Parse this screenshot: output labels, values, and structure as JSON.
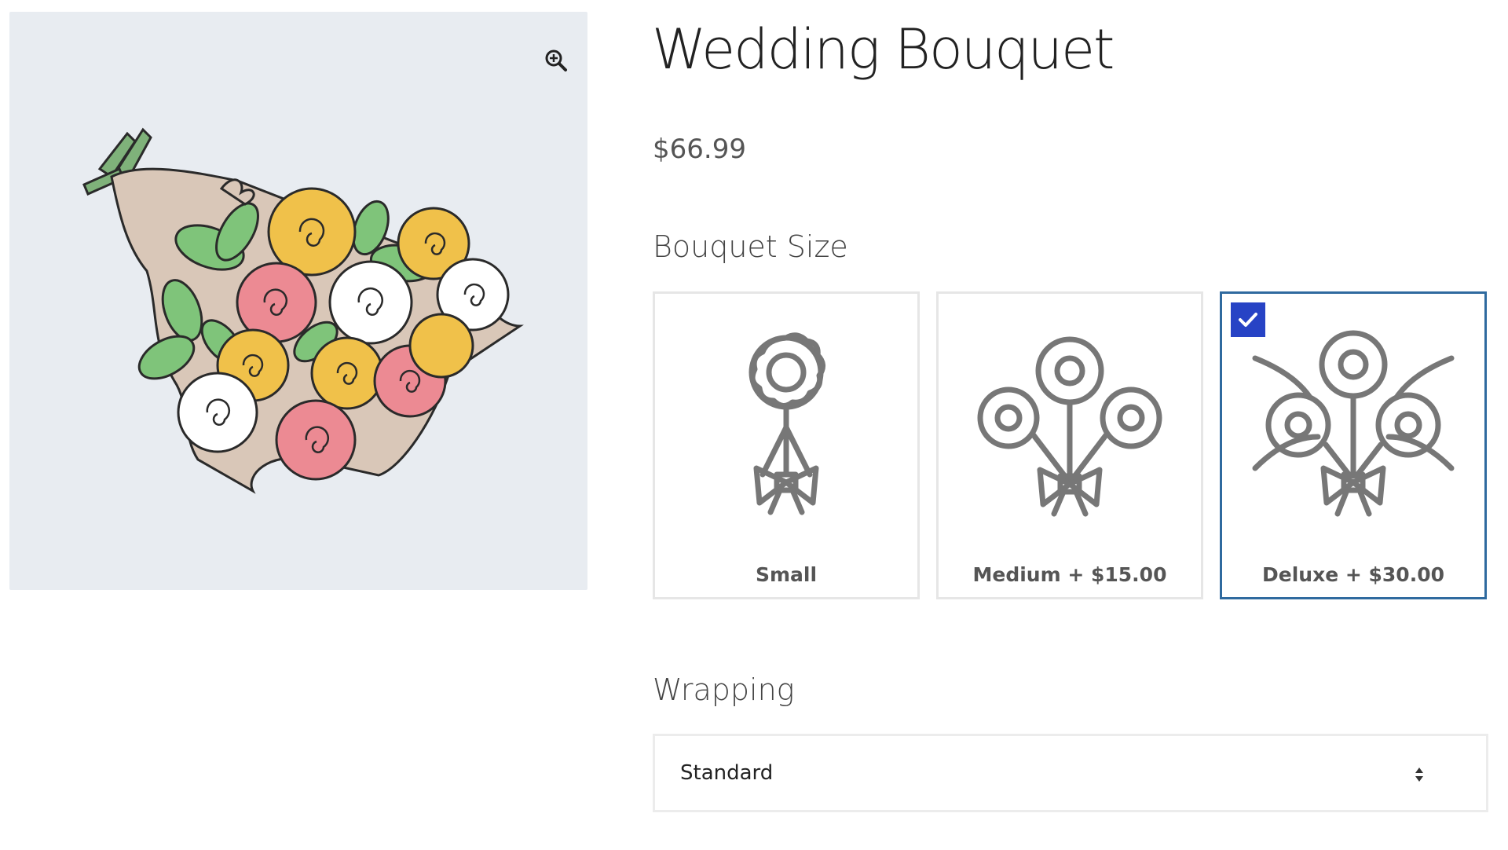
{
  "product": {
    "title": "Wedding Bouquet",
    "price": "$66.99"
  },
  "gallery": {
    "zoom_icon": "zoom-in-icon",
    "image": "illustrated-bouquet-of-roses",
    "background_color": "#e8ecf1"
  },
  "bouquet_size": {
    "label": "Bouquet Size",
    "options": [
      {
        "name": "Small",
        "icon": "single-flower-icon",
        "selected": false
      },
      {
        "name": "Medium + $15.00",
        "icon": "three-flower-bouquet-icon",
        "selected": false
      },
      {
        "name": "Deluxe + $30.00",
        "icon": "deluxe-bouquet-icon",
        "selected": true
      }
    ],
    "selected_border_color": "#2f6a9f",
    "check_badge_color": "#2743c5"
  },
  "wrapping": {
    "label": "Wrapping",
    "selected_value": "Standard"
  }
}
